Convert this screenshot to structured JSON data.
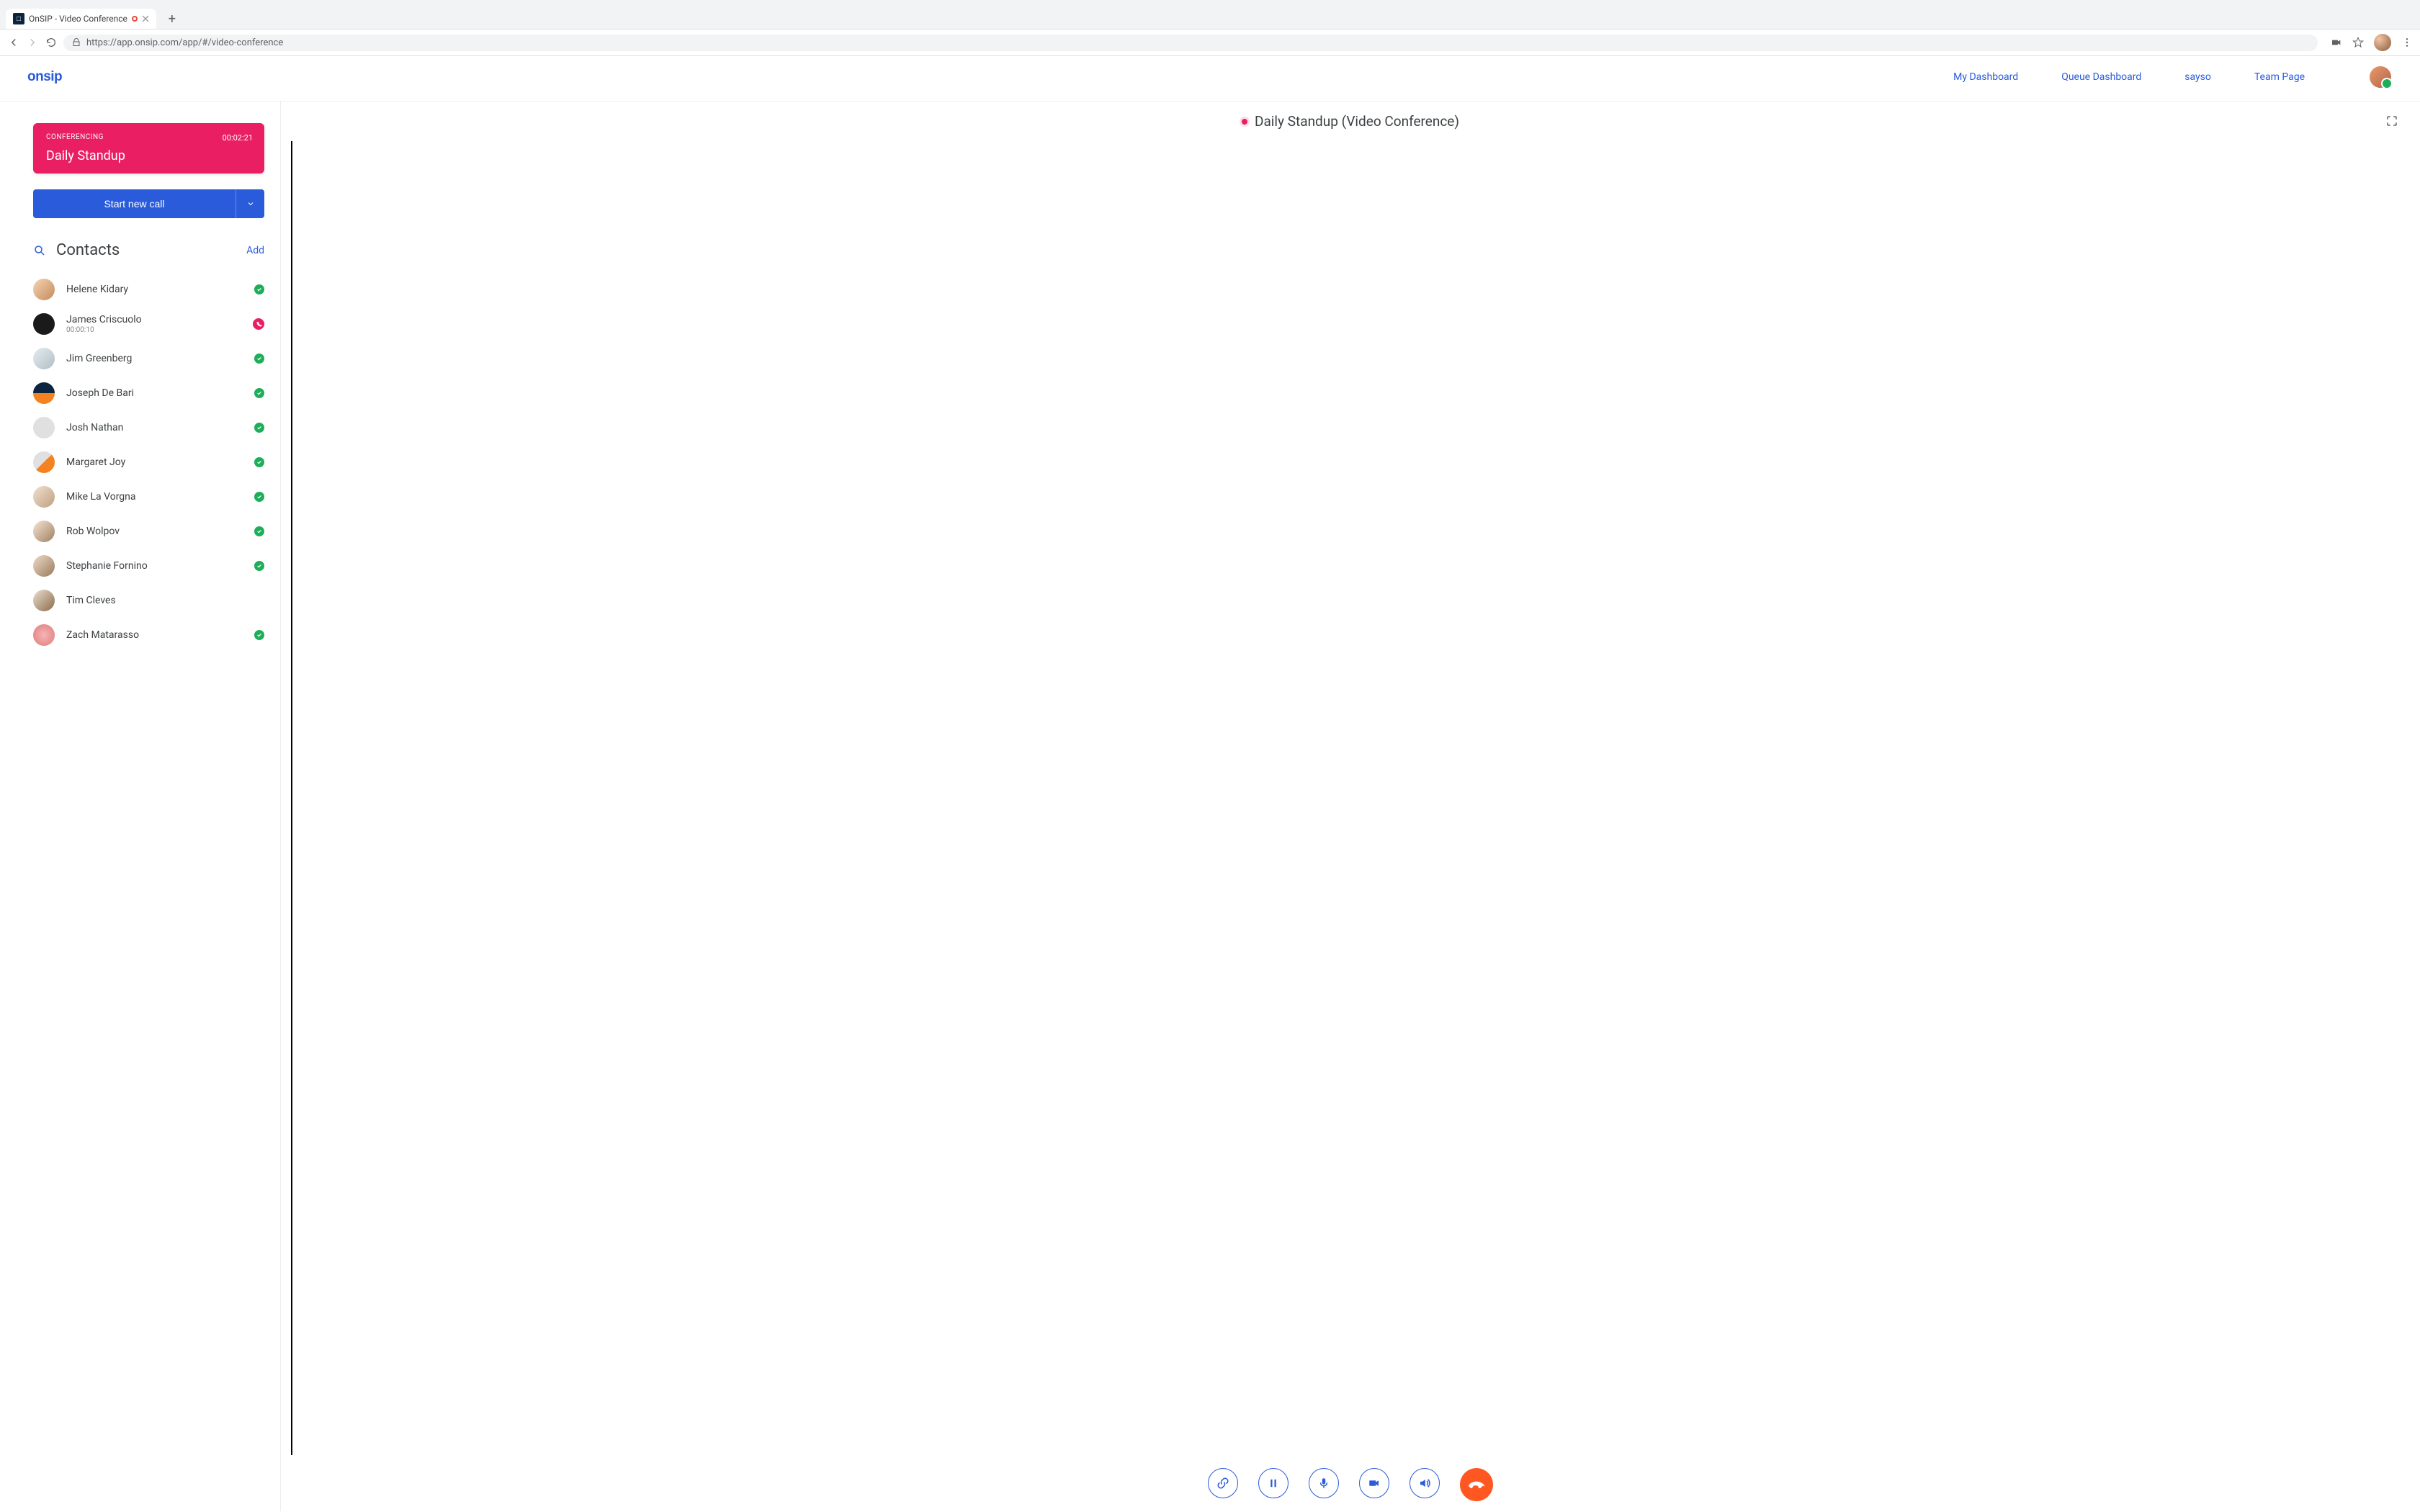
{
  "browser": {
    "tab_title": "OnSIP - Video Conference",
    "url": "https://app.onsip.com/app/#/video-conference"
  },
  "header": {
    "logo_text": "onsip",
    "nav": {
      "dashboard": "My Dashboard",
      "queue": "Queue Dashboard",
      "sayso": "sayso",
      "team": "Team Page"
    }
  },
  "sidebar": {
    "conference": {
      "label": "CONFERENCING",
      "timer": "00:02:21",
      "title": "Daily Standup"
    },
    "start_call_label": "Start new call",
    "contacts_title": "Contacts",
    "add_label": "Add",
    "contacts": [
      {
        "name": "Helene Kidary",
        "status": "available"
      },
      {
        "name": "James Criscuolo",
        "sub": "00:00:10",
        "status": "calling"
      },
      {
        "name": "Jim Greenberg",
        "status": "available"
      },
      {
        "name": "Joseph De Bari",
        "status": "available"
      },
      {
        "name": "Josh Nathan",
        "status": "available"
      },
      {
        "name": "Margaret Joy",
        "status": "available"
      },
      {
        "name": "Mike La Vorgna",
        "status": "available"
      },
      {
        "name": "Rob Wolpov",
        "status": "available"
      },
      {
        "name": "Stephanie Fornino",
        "status": "available"
      },
      {
        "name": "Tim Cleves",
        "status": "none"
      },
      {
        "name": "Zach Matarasso",
        "status": "available"
      }
    ]
  },
  "main": {
    "title": "Daily Standup (Video Conference)"
  }
}
